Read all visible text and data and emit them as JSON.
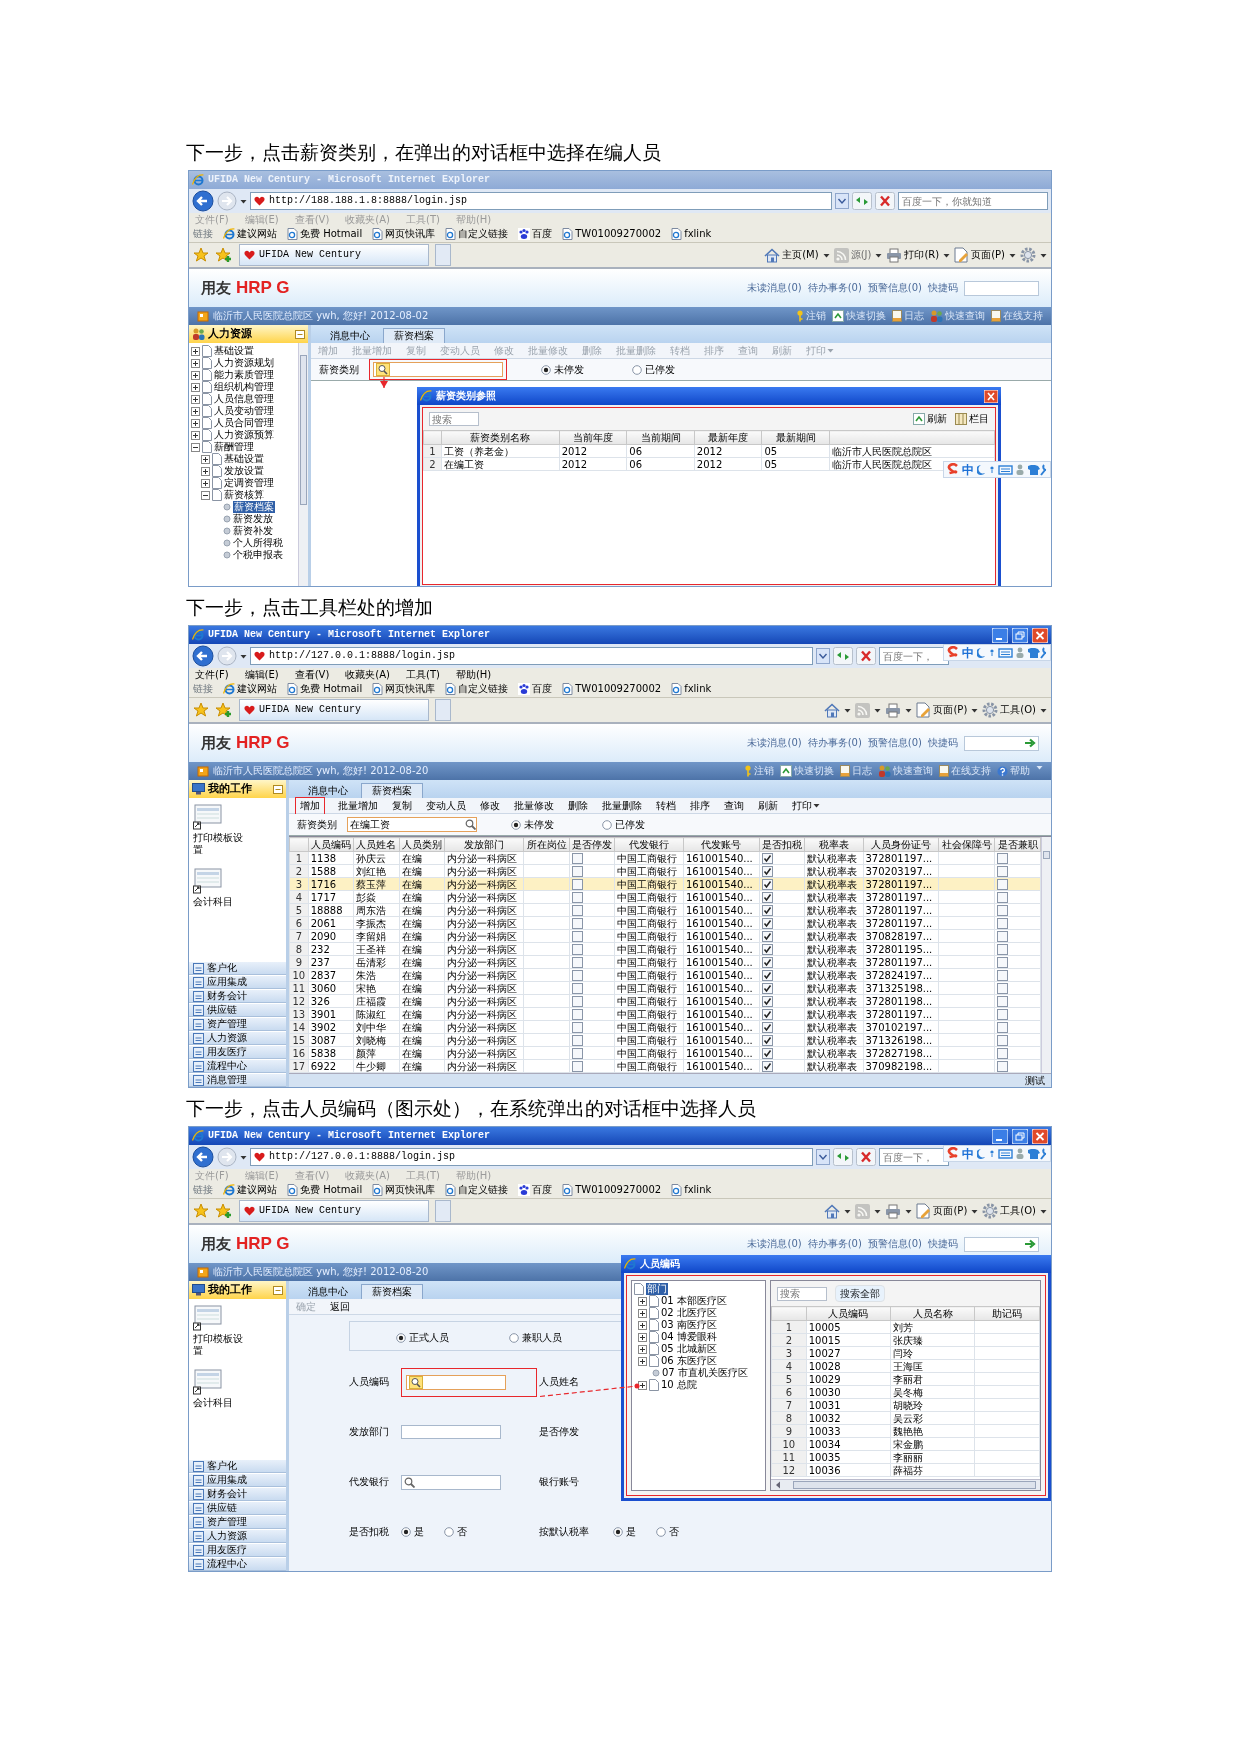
{
  "steps": [
    {
      "kind": "category_dialog",
      "caption": "下一步，点击薪资类别，在弹出的对话框中选择在编人员",
      "window": {
        "title": "UFIDA New Century - Microsoft Internet Explorer",
        "active": false,
        "address": "http://188.188.1.8:8888/login.jsp",
        "search_placeholder": "百度一下，你就知道",
        "menu_greyed": true,
        "menu": [
          "文件(F)",
          "编辑(E)",
          "查看(V)",
          "收藏夹(A)",
          "工具(T)",
          "帮助(H)"
        ],
        "links_label": "链接",
        "links": [
          {
            "label": "建议网站",
            "kind": "ie"
          },
          {
            "label": "免费 Hotmail",
            "kind": "page"
          },
          {
            "label": "网页快讯库",
            "kind": "page"
          },
          {
            "label": "自定义链接",
            "kind": "page"
          },
          {
            "label": "百度",
            "kind": "baidu"
          },
          {
            "label": "TW01009270002",
            "kind": "page"
          },
          {
            "label": "fxlink",
            "kind": "page"
          }
        ],
        "tab": "UFIDA New Century",
        "commands": [
          {
            "kind": "home",
            "label": "主页(M)",
            "disabled": false
          },
          {
            "kind": "feed",
            "label": "源(J)",
            "disabled": true
          },
          {
            "kind": "print",
            "label": "打印(R)",
            "disabled": false
          },
          {
            "kind": "page",
            "label": "页面(P)",
            "disabled": false
          },
          {
            "kind": "tools",
            "disabled": false
          }
        ],
        "ime_label": "中"
      },
      "app": {
        "logo_brand": "用友",
        "logo_product": "HRP G",
        "header_links": [
          "未读消息(0)",
          "待办事务(0)",
          "预警信息(0)",
          "快捷码"
        ],
        "info": "临沂市人民医院总院区 ywh, 您好! 2012-08-02",
        "info_actions": [
          {
            "label": "注销",
            "kind": "key"
          },
          {
            "label": "快速切换",
            "kind": "switch"
          },
          {
            "label": "日志",
            "kind": "log"
          },
          {
            "label": "快速查询",
            "kind": "people"
          },
          {
            "label": "在线支持",
            "kind": "log"
          }
        ],
        "sidebar": {
          "title": "人力资源",
          "tree": [
            {
              "label": "基础设置",
              "expanded": false
            },
            {
              "label": "人力资源规划",
              "expanded": false
            },
            {
              "label": "能力素质管理",
              "expanded": false
            },
            {
              "label": "组织机构管理",
              "expanded": false
            },
            {
              "label": "人员信息管理",
              "expanded": false
            },
            {
              "label": "人员变动管理",
              "expanded": false
            },
            {
              "label": "人员合同管理",
              "expanded": false
            },
            {
              "label": "人力资源预算",
              "expanded": false
            },
            {
              "label": "薪酬管理",
              "expanded": true,
              "children": [
                {
                  "label": "基础设置",
                  "expanded": false
                },
                {
                  "label": "发放设置",
                  "expanded": false
                },
                {
                  "label": "定调资管理",
                  "expanded": false
                },
                {
                  "label": "薪资核算",
                  "expanded": true,
                  "leaves": [
                    {
                      "label": "薪资档案",
                      "selected": true
                    },
                    {
                      "label": "薪资发放",
                      "selected": false
                    },
                    {
                      "label": "薪资补发",
                      "selected": false
                    },
                    {
                      "label": "个人所得税",
                      "selected": false
                    },
                    {
                      "label": "个税申报表",
                      "selected": false
                    }
                  ]
                }
              ]
            }
          ]
        },
        "tabs": [
          {
            "label": "消息中心",
            "selected": false
          },
          {
            "label": "薪资档案",
            "selected": true
          }
        ],
        "toolbar": [
          {
            "label": "增加",
            "disabled": true,
            "highlighted": false
          },
          {
            "label": "批量增加",
            "disabled": true,
            "highlighted": false
          },
          {
            "label": "复制",
            "disabled": true,
            "highlighted": false
          },
          {
            "label": "变动人员",
            "disabled": true,
            "highlighted": false
          },
          {
            "label": "修改",
            "disabled": true,
            "highlighted": false
          },
          {
            "label": "批量修改",
            "disabled": true,
            "highlighted": false
          },
          {
            "label": "删除",
            "disabled": true,
            "highlighted": false
          },
          {
            "label": "批量删除",
            "disabled": true,
            "highlighted": false
          },
          {
            "label": "转档",
            "disabled": true,
            "highlighted": false
          },
          {
            "label": "排序",
            "disabled": true,
            "highlighted": false
          },
          {
            "label": "查询",
            "disabled": true,
            "highlighted": false
          },
          {
            "label": "刷新",
            "disabled": true,
            "highlighted": false
          },
          {
            "label": "打印",
            "disabled": true,
            "highlighted": false,
            "dropdown": true
          }
        ],
        "filter": {
          "label": "薪资类别",
          "highlighted": true,
          "radios": [
            {
              "label": "未停发",
              "selected": true
            },
            {
              "label": "已停发",
              "selected": false
            }
          ]
        },
        "dialog": {
          "title": "薪资类别参照",
          "search_placeholder": "搜索",
          "actions": [
            {
              "label": "刷新",
              "kind": "refresh"
            },
            {
              "label": "栏目",
              "kind": "columns"
            }
          ],
          "highlighted": true,
          "columns": [
            "",
            "薪资类别名称",
            "当前年度",
            "当前期间",
            "最新年度",
            "最新期间",
            ""
          ],
          "rows": [
            [
              "1",
              "工资（养老金）",
              "2012",
              "06",
              "2012",
              "05",
              "临沂市人民医院总院区"
            ],
            [
              "2",
              "在编工资",
              "2012",
              "06",
              "2012",
              "05",
              "临沂市人民医院总院区"
            ]
          ]
        }
      }
    },
    {
      "kind": "staff_list",
      "caption": "下一步，点击工具栏处的增加",
      "window": {
        "title": "UFIDA New Century - Microsoft Internet Explorer",
        "active": true,
        "controls": true,
        "address": "http://127.0.0.1:8888/login.jsp",
        "search_placeholder": "百度一下，",
        "menu_greyed": false,
        "menu": [
          "文件(F)",
          "编辑(E)",
          "查看(V)",
          "收藏夹(A)",
          "工具(T)",
          "帮助(H)"
        ],
        "links_label": "链接",
        "links": [
          {
            "label": "建议网站",
            "kind": "ie"
          },
          {
            "label": "免费 Hotmail",
            "kind": "page"
          },
          {
            "label": "网页快讯库",
            "kind": "page"
          },
          {
            "label": "自定义链接",
            "kind": "page"
          },
          {
            "label": "百度",
            "kind": "baidu"
          },
          {
            "label": "TW01009270002",
            "kind": "page"
          },
          {
            "label": "fxlink",
            "kind": "page"
          }
        ],
        "tab": "UFIDA New Century",
        "commands": [
          {
            "kind": "home",
            "disabled": false
          },
          {
            "kind": "feed",
            "disabled": true
          },
          {
            "kind": "print",
            "disabled": false
          },
          {
            "kind": "page",
            "label": "页面(P)",
            "disabled": false
          },
          {
            "kind": "tools",
            "label": "工具(O)",
            "disabled": false
          }
        ],
        "ime_label": "中"
      },
      "app": {
        "logo_brand": "用友",
        "logo_product": "HRP G",
        "quick_code_go": true,
        "header_links": [
          "未读消息(0)",
          "待办事务(0)",
          "预警信息(0)",
          "快捷码"
        ],
        "info": "临沂市人民医院总院区 ywh, 您好! 2012-08-20",
        "info_actions": [
          {
            "label": "注销",
            "kind": "key"
          },
          {
            "label": "快速切换",
            "kind": "switch"
          },
          {
            "label": "日志",
            "kind": "log"
          },
          {
            "label": "快速查询",
            "kind": "people"
          },
          {
            "label": "在线支持",
            "kind": "log"
          },
          {
            "label": "帮助",
            "kind": "help"
          }
        ],
        "sidebar": {
          "title": "我的工作",
          "shortcuts": [
            "打印模板设置",
            "会计科目"
          ],
          "modules": [
            "客户化",
            "应用集成",
            "财务会计",
            "供应链",
            "资产管理",
            "人力资源",
            "用友医疗",
            "流程中心",
            "消息管理"
          ]
        },
        "tabs": [
          {
            "label": "消息中心",
            "selected": false
          },
          {
            "label": "薪资档案",
            "selected": true
          }
        ],
        "toolbar": [
          {
            "label": "增加",
            "disabled": false,
            "highlighted": true
          },
          {
            "label": "批量增加",
            "disabled": false,
            "highlighted": false
          },
          {
            "label": "复制",
            "disabled": false,
            "highlighted": false
          },
          {
            "label": "变动人员",
            "disabled": false,
            "highlighted": false
          },
          {
            "label": "修改",
            "disabled": false,
            "highlighted": false
          },
          {
            "label": "批量修改",
            "disabled": false,
            "highlighted": false
          },
          {
            "label": "删除",
            "disabled": false,
            "highlighted": false
          },
          {
            "label": "批量删除",
            "disabled": false,
            "highlighted": false
          },
          {
            "label": "转档",
            "disabled": false,
            "highlighted": false
          },
          {
            "label": "排序",
            "disabled": false,
            "highlighted": false
          },
          {
            "label": "查询",
            "disabled": false,
            "highlighted": false
          },
          {
            "label": "刷新",
            "disabled": false,
            "highlighted": false
          },
          {
            "label": "打印",
            "disabled": false,
            "highlighted": false,
            "dropdown": true
          }
        ],
        "filter": {
          "label": "薪资类别",
          "value": "在编工资",
          "highlighted": false,
          "radios": [
            {
              "label": "未停发",
              "selected": true
            },
            {
              "label": "已停发",
              "selected": false
            }
          ]
        },
        "table": {
          "columns": [
            "人员编码",
            "人员姓名",
            "人员类别",
            "发放部门",
            "所在岗位",
            "是否停发",
            "代发银行",
            "代发账号",
            "是否扣税",
            "税率表",
            "人员身份证号",
            "社会保障号",
            "是否兼职"
          ],
          "rows": [
            {
              "no": "1",
              "code": "1138",
              "name": "孙庆云",
              "type": "在编",
              "dept": "内分泌一科病区",
              "stopped": false,
              "bank": "中国工商银行",
              "account": "161001540...",
              "tax": true,
              "rate_table": "默认税率表",
              "id_number": "372801197...",
              "part_time": false,
              "selected": false
            },
            {
              "no": "2",
              "code": "1588",
              "name": "刘红艳",
              "type": "在编",
              "dept": "内分泌一科病区",
              "stopped": false,
              "bank": "中国工商银行",
              "account": "161001540...",
              "tax": true,
              "rate_table": "默认税率表",
              "id_number": "370203197...",
              "part_time": false,
              "selected": false
            },
            {
              "no": "3",
              "code": "1716",
              "name": "蔡玉萍",
              "type": "在编",
              "dept": "内分泌一科病区",
              "stopped": false,
              "bank": "中国工商银行",
              "account": "161001540...",
              "tax": true,
              "rate_table": "默认税率表",
              "id_number": "372801197...",
              "part_time": false,
              "selected": true
            },
            {
              "no": "4",
              "code": "1717",
              "name": "彭焱",
              "type": "在编",
              "dept": "内分泌一科病区",
              "stopped": false,
              "bank": "中国工商银行",
              "account": "161001540...",
              "tax": true,
              "rate_table": "默认税率表",
              "id_number": "372801197...",
              "part_time": false,
              "selected": false
            },
            {
              "no": "5",
              "code": "18888",
              "name": "周东浩",
              "type": "在编",
              "dept": "内分泌一科病区",
              "stopped": false,
              "bank": "中国工商银行",
              "account": "161001540...",
              "tax": true,
              "rate_table": "默认税率表",
              "id_number": "372801197...",
              "part_time": false,
              "selected": false
            },
            {
              "no": "6",
              "code": "2061",
              "name": "李振杰",
              "type": "在编",
              "dept": "内分泌一科病区",
              "stopped": false,
              "bank": "中国工商银行",
              "account": "161001540...",
              "tax": true,
              "rate_table": "默认税率表",
              "id_number": "372801197...",
              "part_time": false,
              "selected": false
            },
            {
              "no": "7",
              "code": "2090",
              "name": "李留娟",
              "type": "在编",
              "dept": "内分泌一科病区",
              "stopped": false,
              "bank": "中国工商银行",
              "account": "161001540...",
              "tax": true,
              "rate_table": "默认税率表",
              "id_number": "370828197...",
              "part_time": false,
              "selected": false
            },
            {
              "no": "8",
              "code": "232",
              "name": "王圣祥",
              "type": "在编",
              "dept": "内分泌一科病区",
              "stopped": false,
              "bank": "中国工商银行",
              "account": "161001540...",
              "tax": true,
              "rate_table": "默认税率表",
              "id_number": "372801195...",
              "part_time": false,
              "selected": false
            },
            {
              "no": "9",
              "code": "237",
              "name": "岳清彩",
              "type": "在编",
              "dept": "内分泌一科病区",
              "stopped": false,
              "bank": "中国工商银行",
              "account": "161001540...",
              "tax": true,
              "rate_table": "默认税率表",
              "id_number": "372801197...",
              "part_time": false,
              "selected": false
            },
            {
              "no": "10",
              "code": "2837",
              "name": "朱浩",
              "type": "在编",
              "dept": "内分泌一科病区",
              "stopped": false,
              "bank": "中国工商银行",
              "account": "161001540...",
              "tax": true,
              "rate_table": "默认税率表",
              "id_number": "372824197...",
              "part_time": false,
              "selected": false
            },
            {
              "no": "11",
              "code": "3060",
              "name": "宋艳",
              "type": "在编",
              "dept": "内分泌一科病区",
              "stopped": false,
              "bank": "中国工商银行",
              "account": "161001540...",
              "tax": true,
              "rate_table": "默认税率表",
              "id_number": "371325198...",
              "part_time": false,
              "selected": false
            },
            {
              "no": "12",
              "code": "326",
              "name": "庄福霞",
              "type": "在编",
              "dept": "内分泌一科病区",
              "stopped": false,
              "bank": "中国工商银行",
              "account": "161001540...",
              "tax": true,
              "rate_table": "默认税率表",
              "id_number": "372801198...",
              "part_time": false,
              "selected": false
            },
            {
              "no": "13",
              "code": "3901",
              "name": "陈淑红",
              "type": "在编",
              "dept": "内分泌一科病区",
              "stopped": false,
              "bank": "中国工商银行",
              "account": "161001540...",
              "tax": true,
              "rate_table": "默认税率表",
              "id_number": "372801197...",
              "part_time": false,
              "selected": false
            },
            {
              "no": "14",
              "code": "3902",
              "name": "刘中华",
              "type": "在编",
              "dept": "内分泌一科病区",
              "stopped": false,
              "bank": "中国工商银行",
              "account": "161001540...",
              "tax": true,
              "rate_table": "默认税率表",
              "id_number": "370102197...",
              "part_time": false,
              "selected": false
            },
            {
              "no": "15",
              "code": "3087",
              "name": "刘晓梅",
              "type": "在编",
              "dept": "内分泌一科病区",
              "stopped": false,
              "bank": "中国工商银行",
              "account": "161001540...",
              "tax": true,
              "rate_table": "默认税率表",
              "id_number": "371326198...",
              "part_time": false,
              "selected": false
            },
            {
              "no": "16",
              "code": "5838",
              "name": "颜萍",
              "type": "在编",
              "dept": "内分泌一科病区",
              "stopped": false,
              "bank": "中国工商银行",
              "account": "161001540...",
              "tax": true,
              "rate_table": "默认税率表",
              "id_number": "372827198...",
              "part_time": false,
              "selected": false
            },
            {
              "no": "17",
              "code": "6922",
              "name": "牛少卿",
              "type": "在编",
              "dept": "内分泌一科病区",
              "stopped": false,
              "bank": "中国工商银行",
              "account": "161001540...",
              "tax": true,
              "rate_table": "默认税率表",
              "id_number": "370982198...",
              "part_time": false,
              "selected": false
            }
          ]
        },
        "status": "测试"
      }
    },
    {
      "kind": "staff_form",
      "caption": "下一步，点击人员编码（图示处），在系统弹出的对话框中选择人员",
      "window": {
        "title": "UFIDA New Century - Microsoft Internet Explorer",
        "active": true,
        "controls": true,
        "address": "http://127.0.0.1:8888/login.jsp",
        "search_placeholder": "百度一下，",
        "menu_greyed": true,
        "menu": [
          "文件(F)",
          "编辑(E)",
          "查看(V)",
          "收藏夹(A)",
          "工具(T)",
          "帮助(H)"
        ],
        "links_label": "链接",
        "links": [
          {
            "label": "建议网站",
            "kind": "ie"
          },
          {
            "label": "免费 Hotmail",
            "kind": "page"
          },
          {
            "label": "网页快讯库",
            "kind": "page"
          },
          {
            "label": "自定义链接",
            "kind": "page"
          },
          {
            "label": "百度",
            "kind": "baidu"
          },
          {
            "label": "TW01009270002",
            "kind": "page"
          },
          {
            "label": "fxlink",
            "kind": "page"
          }
        ],
        "tab": "UFIDA New Century",
        "commands": [
          {
            "kind": "home",
            "disabled": false
          },
          {
            "kind": "feed",
            "disabled": true
          },
          {
            "kind": "print",
            "disabled": false
          },
          {
            "kind": "page",
            "label": "页面(P)",
            "disabled": false
          },
          {
            "kind": "tools",
            "label": "工具(O)",
            "disabled": false
          }
        ],
        "ime_label": "中"
      },
      "app": {
        "logo_brand": "用友",
        "logo_product": "HRP G",
        "quick_code_go": true,
        "header_links": [
          "未读消息(0)",
          "待办事务(0)",
          "预警信息(0)",
          "快捷码"
        ],
        "info": "临沂市人民医院总院区 ywh, 您好! 2012-08-20",
        "sidebar": {
          "title": "我的工作",
          "shortcuts": [
            "打印模板设置",
            "会计科目"
          ],
          "modules": [
            "客户化",
            "应用集成",
            "财务会计",
            "供应链",
            "资产管理",
            "人力资源",
            "用友医疗",
            "流程中心"
          ]
        },
        "tabs": [
          {
            "label": "消息中心",
            "selected": false
          },
          {
            "label": "薪资档案",
            "selected": true
          }
        ],
        "toolbar": [
          {
            "label": "确定",
            "disabled": true,
            "highlighted": false
          },
          {
            "label": "返回",
            "disabled": false,
            "highlighted": false
          }
        ],
        "form": {
          "staff_types": [
            {
              "label": "正式人员",
              "selected": true
            },
            {
              "label": "兼职人员",
              "selected": false
            }
          ],
          "rows": [
            {
              "left": {
                "label": "人员编码",
                "kind": "lookup",
                "highlighted": true
              },
              "right": {
                "label": "人员姓名"
              }
            },
            {
              "left": {
                "label": "发放部门",
                "kind": "text",
                "highlighted": false
              },
              "right": {
                "label": "是否停发"
              }
            },
            {
              "left": {
                "label": "代发银行",
                "kind": "lookup",
                "highlighted": false
              },
              "right": {
                "label": "银行账号"
              }
            },
            {
              "left": {
                "label": "是否扣税",
                "kind": "radios",
                "highlighted": false,
                "options": [
                  {
                    "label": "是",
                    "selected": true
                  },
                  {
                    "label": "否",
                    "selected": false
                  }
                ]
              },
              "right": {
                "label": "按默认税率",
                "options": [
                  {
                    "label": "是",
                    "selected": true
                  },
                  {
                    "label": "否",
                    "selected": false
                  }
                ]
              }
            }
          ]
        },
        "dialog": {
          "title": "人员编码",
          "highlighted": true,
          "tree": {
            "label": "部门",
            "selected": true,
            "children": [
              {
                "label": "01 本部医疗区",
                "kind": "folder"
              },
              {
                "label": "02 北医疗区",
                "kind": "folder"
              },
              {
                "label": "03 南医疗区",
                "kind": "folder"
              },
              {
                "label": "04 博爱眼科",
                "kind": "folder"
              },
              {
                "label": "05 北城新区",
                "kind": "folder"
              },
              {
                "label": "06 东医疗区",
                "kind": "folder"
              },
              {
                "label": "07 市直机关医疗区",
                "kind": "leaf"
              },
              {
                "label": "10 总院",
                "kind": "folder"
              }
            ]
          },
          "search_placeholder": "搜索",
          "search_button": "搜索全部",
          "columns": [
            "",
            "人员编码",
            "人员名称",
            "助记码"
          ],
          "rows": [
            [
              "1",
              "10005",
              "刘芳"
            ],
            [
              "2",
              "10015",
              "张庆臻"
            ],
            [
              "3",
              "10027",
              "闫玲"
            ],
            [
              "4",
              "10028",
              "王海匡"
            ],
            [
              "5",
              "10029",
              "李丽君"
            ],
            [
              "6",
              "10030",
              "吴冬梅"
            ],
            [
              "7",
              "10031",
              "胡晓玲"
            ],
            [
              "8",
              "10032",
              "吴云彩"
            ],
            [
              "9",
              "10033",
              "魏艳艳"
            ],
            [
              "10",
              "10034",
              "宋金鹏"
            ],
            [
              "11",
              "10035",
              "李丽丽"
            ],
            [
              "12",
              "10036",
              "薛福芬"
            ]
          ]
        }
      }
    }
  ]
}
